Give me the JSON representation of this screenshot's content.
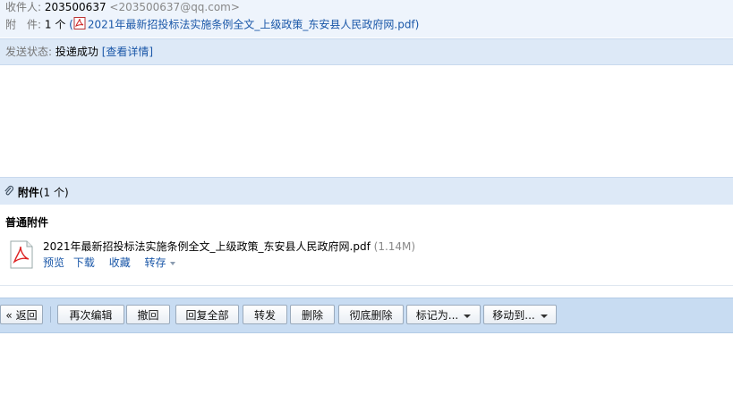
{
  "header": {
    "recipient_label": "收件人:",
    "recipient_name": "203500637",
    "recipient_email": "<203500637@qq.com>",
    "attachment_label": "附　件:",
    "attachment_count": "1 个",
    "attachment_open": "(",
    "attachment_file": "2021年最新招投标法实施条例全文_上级政策_东安县人民政府网.pdf",
    "attachment_close": ")"
  },
  "status": {
    "label": "发送状态:",
    "value": "投递成功",
    "detail_link": "[查看详情]"
  },
  "attachments": {
    "title": "附件",
    "count": "(1 个)",
    "section_title": "普通附件",
    "file_name": "2021年最新招投标法实施条例全文_上级政策_东安县人民政府网.pdf",
    "file_size": "(1.14M)",
    "actions": {
      "preview": "预览",
      "download": "下载",
      "favorite": "收藏",
      "save_to": "转存"
    }
  },
  "toolbar": {
    "back": "« 返回",
    "edit_again": "再次编辑",
    "recall": "撤回",
    "reply_all": "回复全部",
    "forward": "转发",
    "delete": "删除",
    "delete_permanently": "彻底删除",
    "mark_as": "标记为...",
    "move_to": "移动到..."
  },
  "icons": [
    "pdf-icon",
    "paperclip-icon",
    "chevron-down-icon"
  ],
  "colors": {
    "link": "#1a57a8",
    "header_bg": "#eef4fc",
    "bar_bg": "#dde9f7",
    "toolbar_bg": "#c8dcf2"
  }
}
